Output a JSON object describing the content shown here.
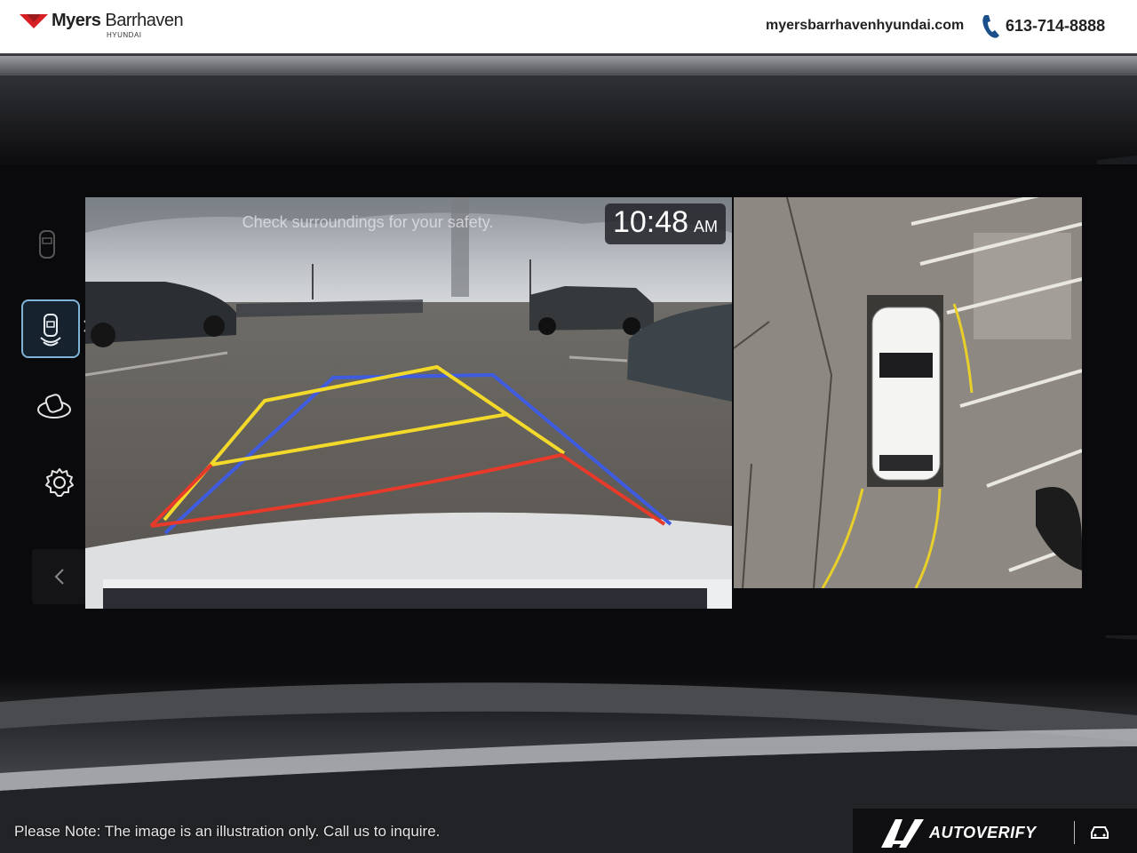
{
  "header": {
    "dealer_name_bold": "Myers",
    "dealer_name_light": "Barrhaven",
    "dealer_sub": "HYUNDAI",
    "website": "myersbarrhavenhyundai.com",
    "phone": "613-714-8888"
  },
  "screen": {
    "camera_warning": "Check surroundings for your safety.",
    "clock_time": "10:48",
    "clock_ampm": "AM",
    "sidebar": [
      {
        "icon": "car-outline-icon",
        "selected": false
      },
      {
        "icon": "rear-sensor-icon",
        "selected": true
      },
      {
        "icon": "360-view-icon",
        "selected": false
      },
      {
        "icon": "gear-icon",
        "selected": false
      },
      {
        "icon": "back-chevron-icon",
        "selected": false
      }
    ],
    "guide_colors": {
      "outer": "#3f5be0",
      "mid": "#f2d92a",
      "near": "#e83a2a"
    }
  },
  "footer": {
    "note": "Please Note: The image is an illustration only. Call us to inquire.",
    "brand": "AUTOVERIFY"
  }
}
